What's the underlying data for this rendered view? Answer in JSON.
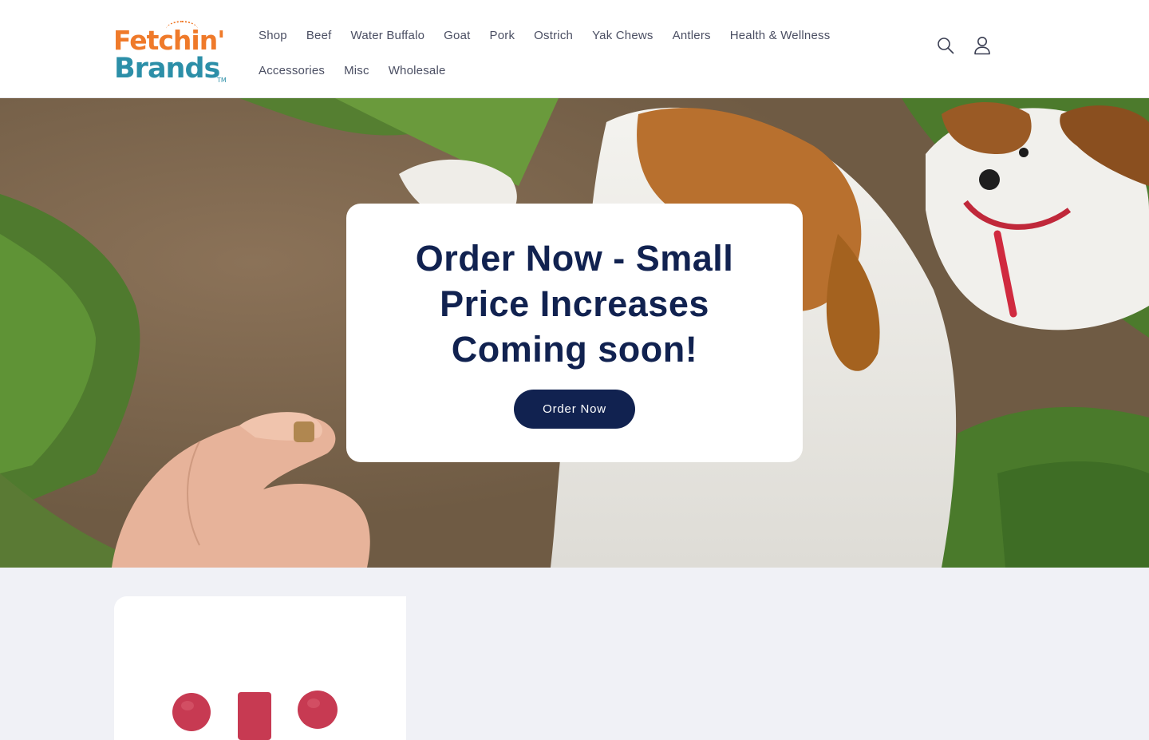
{
  "brand": {
    "logo_line1": "Fetchin'",
    "logo_line2": "Brands",
    "logo_tm": "TM",
    "colors": {
      "orange": "#ef7a2a",
      "teal": "#2c8fa8",
      "navy": "#112250"
    }
  },
  "nav": {
    "row1": [
      {
        "label": "Shop"
      },
      {
        "label": "Beef"
      },
      {
        "label": "Water Buffalo"
      },
      {
        "label": "Goat"
      },
      {
        "label": "Pork"
      },
      {
        "label": "Ostrich"
      },
      {
        "label": "Yak Chews"
      },
      {
        "label": "Antlers"
      },
      {
        "label": "Health & Wellness"
      }
    ],
    "row2": [
      {
        "label": "Accessories"
      },
      {
        "label": "Misc"
      },
      {
        "label": "Wholesale"
      }
    ]
  },
  "header_icons": {
    "search": "search-icon",
    "account": "account-icon"
  },
  "hero": {
    "title": "Order Now - Small Price Increases Coming soon!",
    "button_label": "Order Now",
    "image": "photo of a hand giving a treat to a white and brown jack russell terrier on grass"
  },
  "product_card": {
    "image": "red chew treats product photo"
  }
}
